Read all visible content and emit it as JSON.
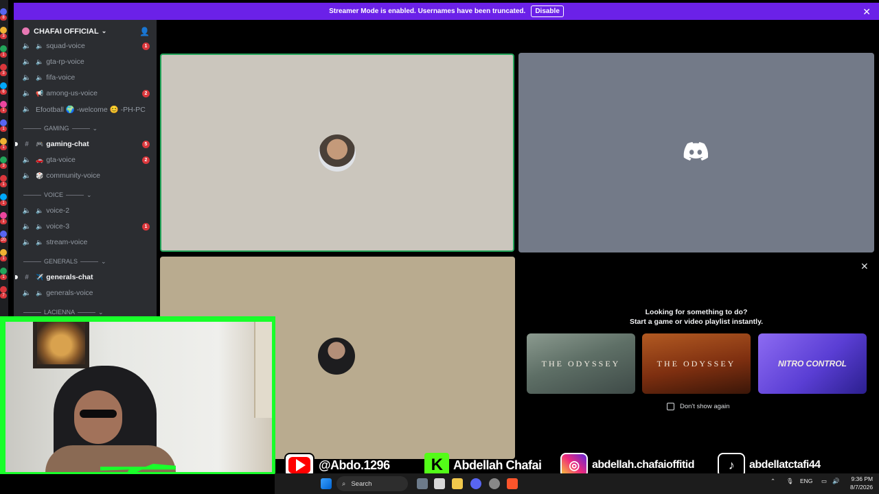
{
  "banner": {
    "text": "Streamer Mode is enabled. Usernames have been truncated.",
    "disable_label": "Disable"
  },
  "rail": {
    "badges": [
      "8",
      "3",
      "1",
      "3",
      "6",
      "1",
      "1",
      "1",
      "3",
      "1",
      "1",
      "1",
      "20",
      "1",
      "1",
      "7"
    ]
  },
  "sidebar": {
    "server_name": "CHAFAI OFFICIAL",
    "channels": [
      {
        "name": "squad-voice",
        "type": "voice",
        "emoji": "🔈",
        "badge": "1"
      },
      {
        "name": "gta-rp-voice",
        "type": "voice",
        "emoji": "🔈",
        "badge": ""
      },
      {
        "name": "fifa-voice",
        "type": "voice",
        "emoji": "🔈",
        "badge": ""
      },
      {
        "name": "among-us-voice",
        "type": "voice",
        "emoji": "📢",
        "badge": "2"
      },
      {
        "name": "Efootball 🌍 -welcome 😊 -PH-PC",
        "type": "voice",
        "emoji": "",
        "badge": ""
      }
    ],
    "cat_gaming": "GAMING",
    "gaming": [
      {
        "name": "gaming-chat",
        "type": "text",
        "emoji": "🎮",
        "badge": "5"
      },
      {
        "name": "gta-voice",
        "type": "voice",
        "emoji": "🚗",
        "badge": "2"
      },
      {
        "name": "community-voice",
        "type": "voice",
        "emoji": "🎲",
        "badge": ""
      }
    ],
    "cat_voice": "VOICE",
    "voice": [
      {
        "name": "voice-2",
        "type": "voice",
        "emoji": "🔈",
        "badge": ""
      },
      {
        "name": "voice-3",
        "type": "voice",
        "emoji": "🔈",
        "badge": "1"
      },
      {
        "name": "stream-voice",
        "type": "voice",
        "emoji": "🔈",
        "badge": ""
      }
    ],
    "cat_generals": "GENERALS",
    "generals": [
      {
        "name": "generals-chat",
        "type": "text",
        "emoji": "✈️",
        "badge": ""
      },
      {
        "name": "generals-voice",
        "type": "voice",
        "emoji": "🔈",
        "badge": ""
      }
    ],
    "cat_lacienna": "LACIENNA"
  },
  "activity": {
    "title_line1": "Looking for something to do?",
    "title_line2": "Start a game or video playlist instantly.",
    "cards": [
      "THE ODYSSEY",
      "THE ODYSSEY",
      "NITRO CONTROL"
    ],
    "dont_show": "Don't show again"
  },
  "socials": {
    "youtube": "@Abdo.1296",
    "kick": "Abdellah Chafai",
    "instagram": "abdellah.chafaioffitid",
    "tiktok": "abdellatctafi44"
  },
  "taskbar": {
    "search_label": "Search",
    "lang": "ENG",
    "time": "9:36 PM",
    "date": "8/7/2026"
  },
  "colors": {
    "banner": "#6b21e8",
    "speaking_border": "#23a55a",
    "webcam_frame": "#19ff2a",
    "badge_red": "#da373c"
  }
}
